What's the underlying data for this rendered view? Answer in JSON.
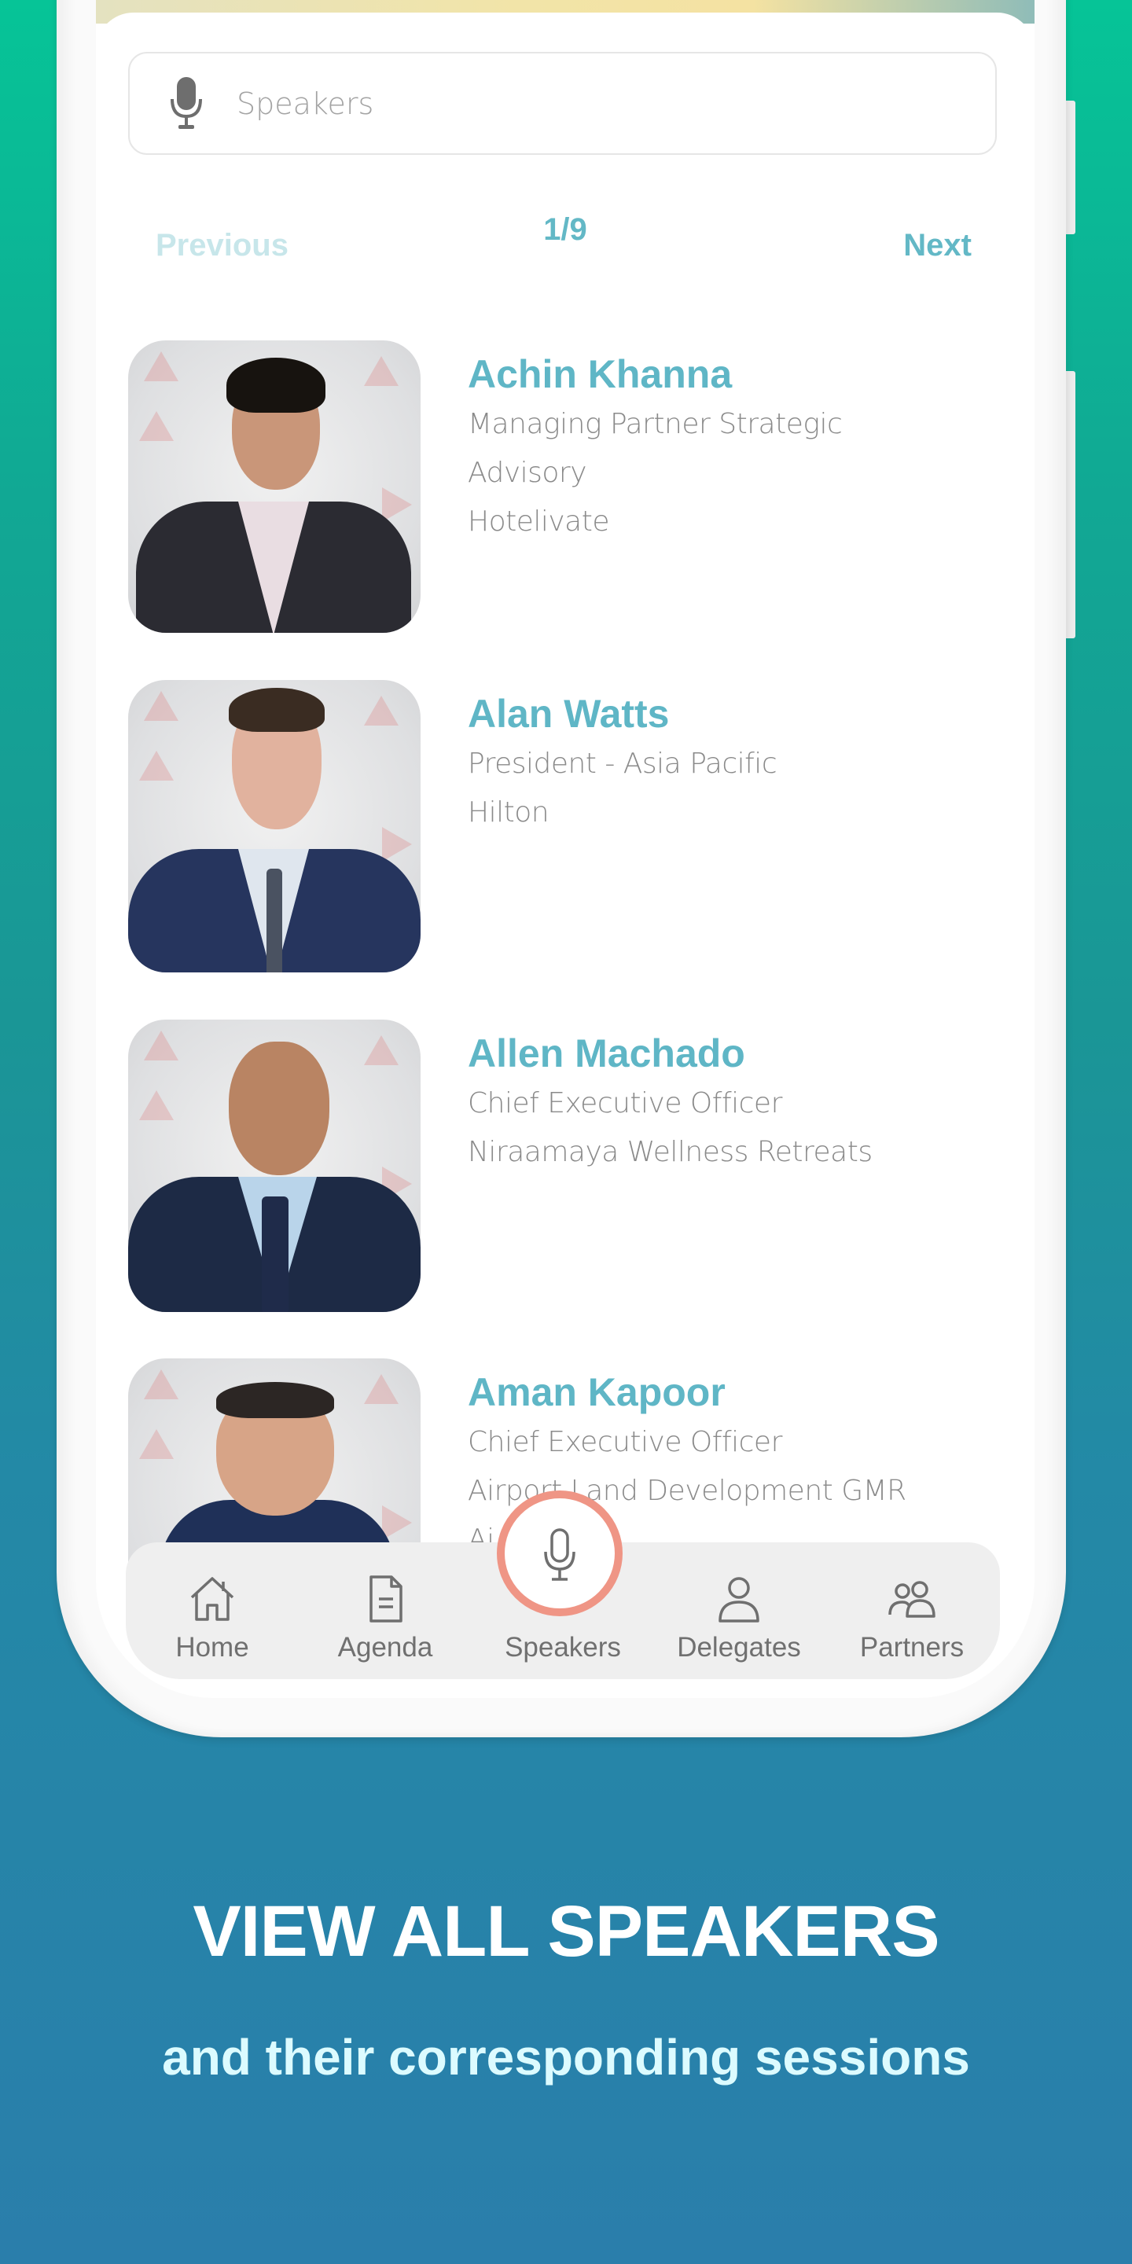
{
  "search": {
    "placeholder": "Speakers",
    "icon": "microphone-icon"
  },
  "pagination": {
    "previous_label": "Previous",
    "current_page": 1,
    "total_pages": 9,
    "indicator": "1/9",
    "next_label": "Next"
  },
  "speakers": [
    {
      "name": "Achin Khanna",
      "lines": [
        "Managing Partner Strategic",
        "Advisory",
        "Hotelivate"
      ]
    },
    {
      "name": "Alan Watts",
      "lines": [
        "President - Asia Pacific",
        "Hilton"
      ]
    },
    {
      "name": "Allen Machado",
      "lines": [
        "Chief Executive Officer",
        "Niraamaya Wellness Retreats"
      ]
    },
    {
      "name": "Aman Kapoor",
      "lines": [
        "Chief Executive Officer",
        "Airport Land Development GMR",
        "Ai"
      ]
    }
  ],
  "bottom_nav": {
    "active": "Speakers",
    "items": [
      {
        "label": "Home",
        "icon": "home-icon"
      },
      {
        "label": "Agenda",
        "icon": "document-icon"
      },
      {
        "label": "Speakers",
        "icon": "microphone-icon"
      },
      {
        "label": "Delegates",
        "icon": "person-icon"
      },
      {
        "label": "Partners",
        "icon": "people-icon"
      }
    ]
  },
  "colors": {
    "accent": "#5fb6c6",
    "active_ring": "#ef9585",
    "background_top": "#06c497",
    "background_bottom": "#2a7eab"
  },
  "promo": {
    "headline": "VIEW ALL SPEAKERS",
    "subheadline": "and their corresponding sessions"
  }
}
